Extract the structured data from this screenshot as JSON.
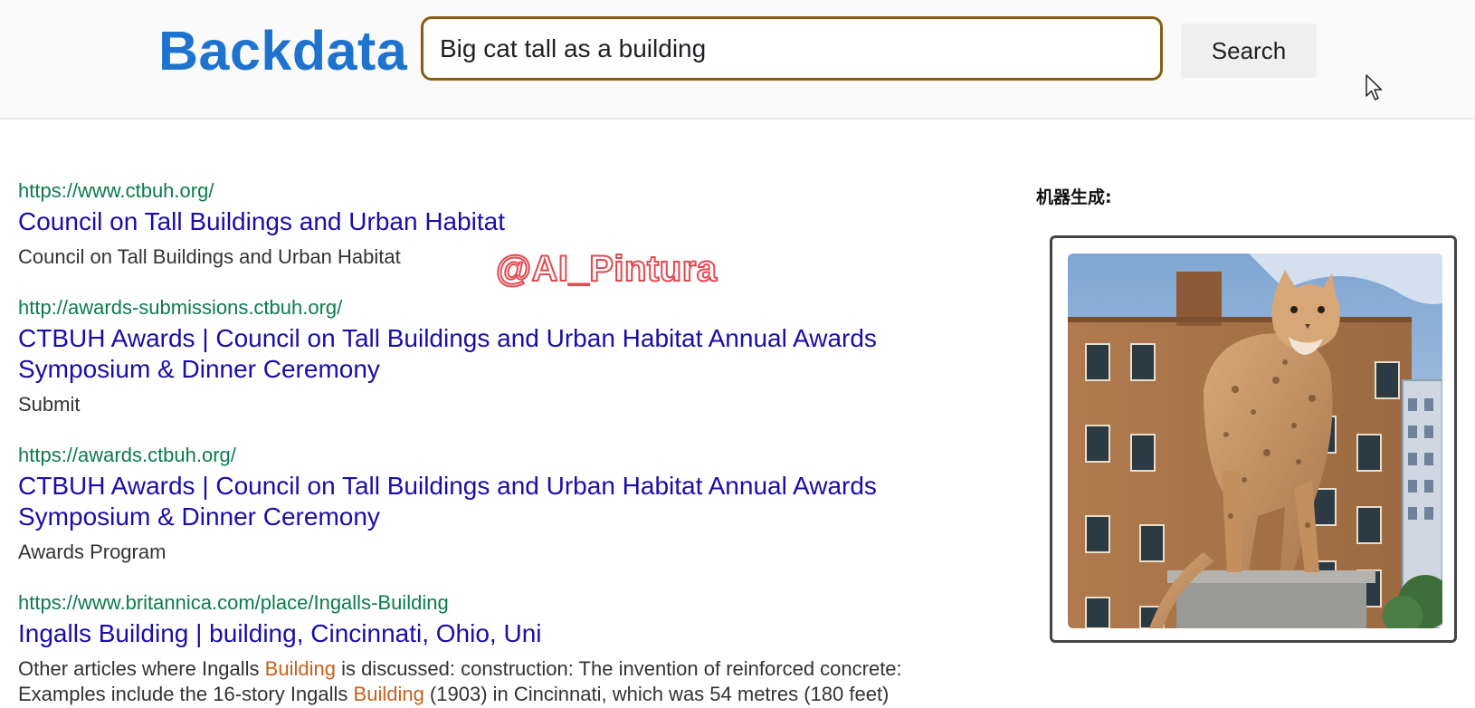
{
  "app": {
    "logo": "Backdata"
  },
  "search": {
    "query": "Big cat tall as a building",
    "button_label": "Search"
  },
  "watermark": "@AI_Pintura",
  "results": [
    {
      "url": "https://www.ctbuh.org/",
      "title": "Council on Tall Buildings and Urban Habitat",
      "snippet": "Council on Tall Buildings and Urban Habitat"
    },
    {
      "url": "http://awards-submissions.ctbuh.org/",
      "title_line1": "CTBUH Awards | Council on Tall Buildings and Urban Habitat Annual Awards",
      "title_line2": "Symposium & Dinner Ceremony",
      "snippet": "Submit"
    },
    {
      "url": "https://awards.ctbuh.org/",
      "title_line1": "CTBUH Awards | Council on Tall Buildings and Urban Habitat Annual Awards",
      "title_line2": "Symposium & Dinner Ceremony",
      "snippet": "Awards Program"
    },
    {
      "url": "https://www.britannica.com/place/Ingalls-Building",
      "title": "Ingalls Building | building, Cincinnati, Ohio, Uni",
      "snippet_parts": {
        "a": "Other articles where Ingalls ",
        "b": "Building",
        "c": " is discussed: construction: The invention of reinforced concrete:",
        "d": "Examples include the 16-story Ingalls ",
        "e": "Building",
        "f": " (1903) in Cincinnati, which was 54 metres (180 feet)"
      }
    }
  ],
  "sidebar": {
    "label": "机器生成:"
  },
  "colors": {
    "logo": "#1e73cf",
    "url": "#0c7a4e",
    "title": "#1a0dab",
    "highlight": "#c6601a",
    "search_border": "#8a5d0e"
  }
}
